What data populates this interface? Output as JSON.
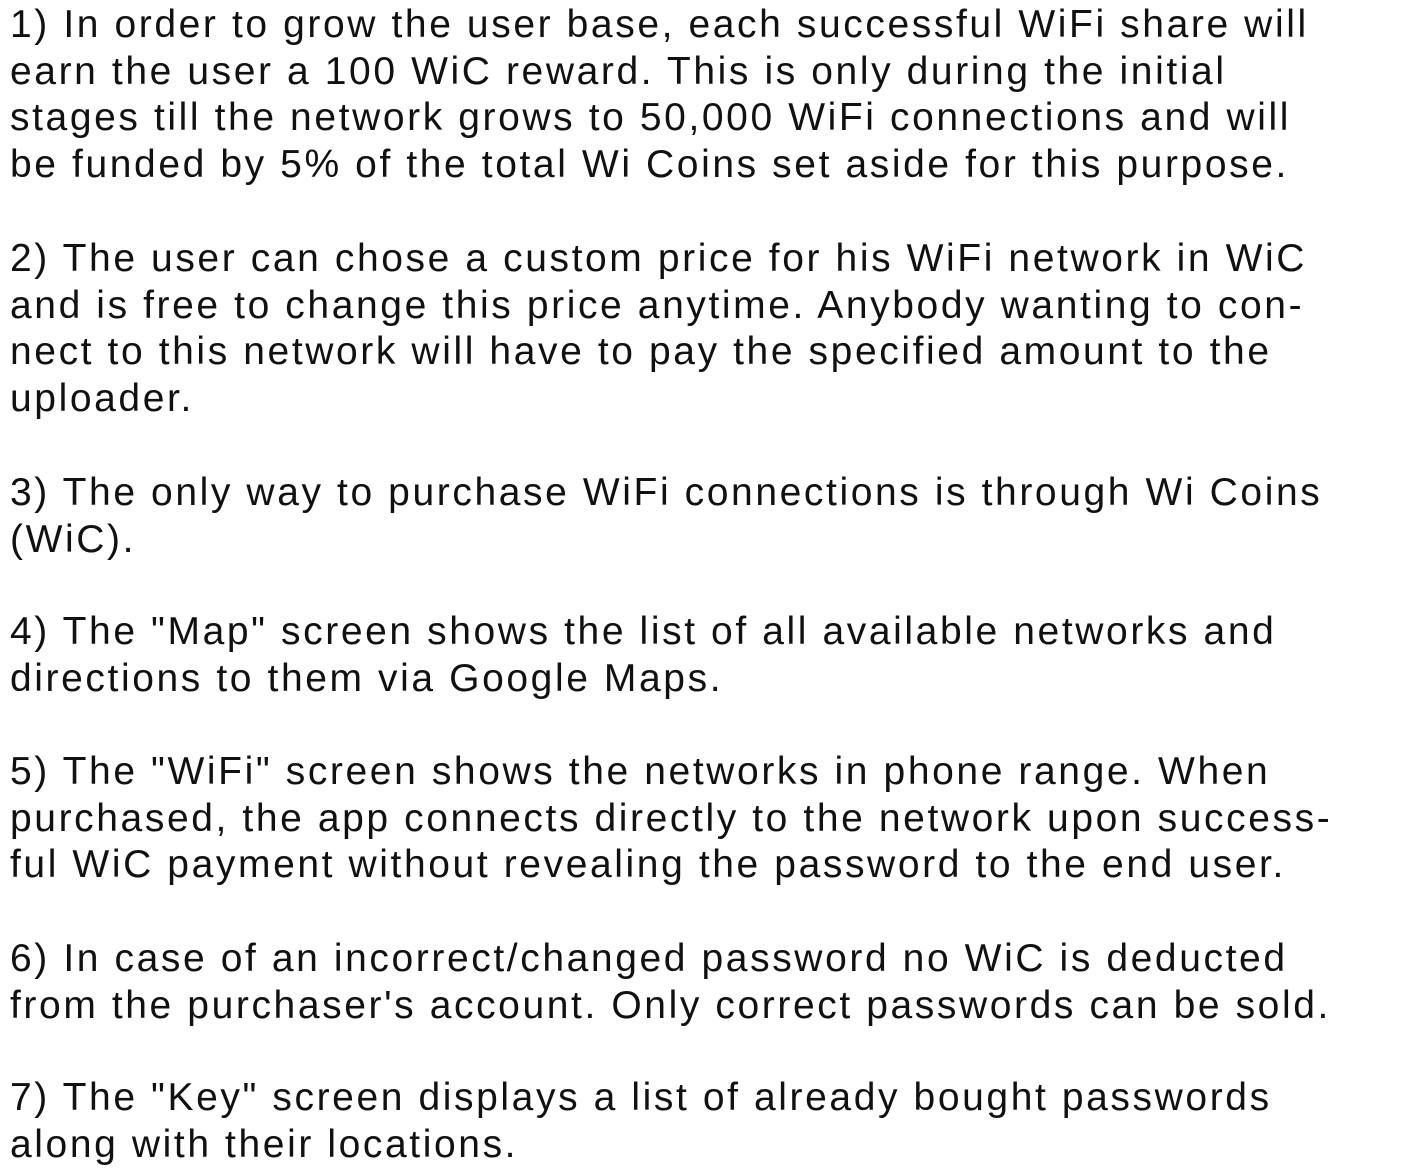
{
  "paragraphs": [
    {
      "lines": [
        "1) In order to grow the user base, each successful WiFi share will",
        "earn the user a 100 WiC reward. This is only during the initial",
        "stages till the network grows to 50,000 WiFi connections and will",
        "be funded by 5% of the total Wi Coins set aside for this purpose."
      ]
    },
    {
      "lines": [
        "2) The user can chose a custom price for his WiFi network in WiC",
        "and is free to change this price anytime. Anybody wanting to con-",
        "nect to this network will have to pay the specified amount to the",
        "uploader."
      ]
    },
    {
      "lines": [
        "3) The only way to purchase WiFi connections is through Wi Coins",
        "(WiC)."
      ]
    },
    {
      "lines": [
        "4) The \"Map\" screen shows the list of all available networks and",
        "directions to them via Google Maps."
      ]
    },
    {
      "lines": [
        "5) The \"WiFi\" screen shows the networks in phone range. When",
        "purchased, the app connects directly to the network upon success-",
        "ful WiC payment without revealing the password to the end user."
      ]
    },
    {
      "lines": [
        "6) In case of an incorrect/changed password no WiC is deducted",
        "from the purchaser's account. Only correct passwords can be sold."
      ]
    },
    {
      "lines": [
        "7) The \"Key\" screen displays a list of already bought passwords",
        "along with their locations."
      ]
    }
  ]
}
